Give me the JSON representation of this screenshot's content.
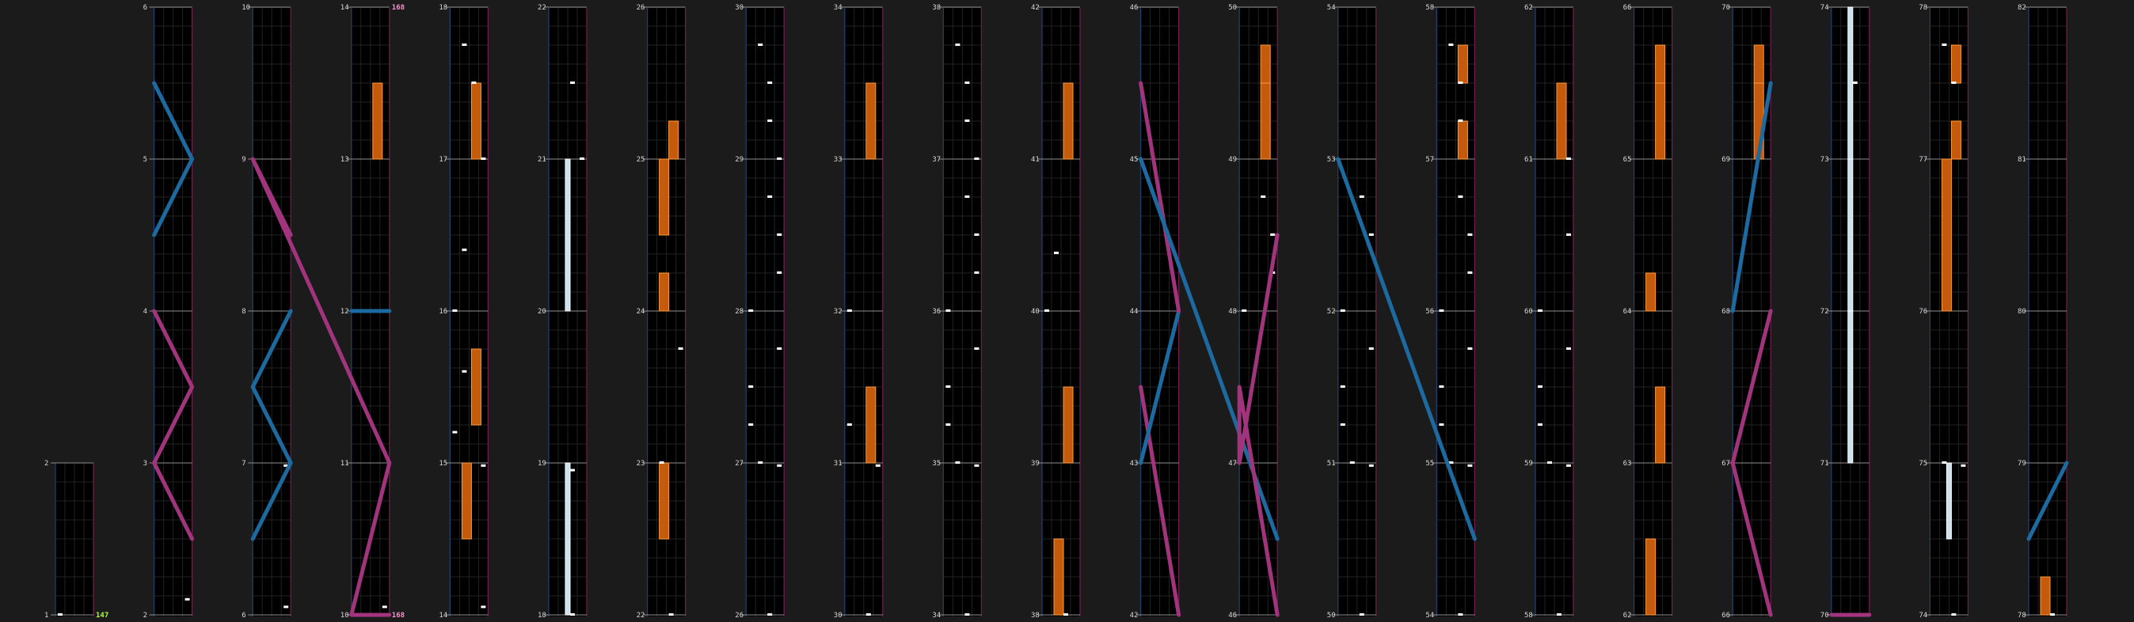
{
  "chart_data": {
    "type": "rhythm-game-chart",
    "measure_labels_shown": true,
    "combo_markers": [
      {
        "measure": 1,
        "value": "147",
        "color": "#b5ff3a"
      },
      {
        "measure": 10,
        "value": "168",
        "color": "#ff8fd2"
      },
      {
        "measure": 10,
        "value": "168",
        "color": "#ff8fd2",
        "at_top": true
      }
    ],
    "columns": [
      {
        "start": 1,
        "measures": 2
      },
      {
        "start": 2,
        "measures": 5
      },
      {
        "start": 6,
        "measures": 5
      },
      {
        "start": 10,
        "measures": 5
      },
      {
        "start": 14,
        "measures": 5
      },
      {
        "start": 18,
        "measures": 5
      },
      {
        "start": 22,
        "measures": 5
      },
      {
        "start": 26,
        "measures": 5
      },
      {
        "start": 30,
        "measures": 5
      },
      {
        "start": 34,
        "measures": 5
      },
      {
        "start": 38,
        "measures": 5
      },
      {
        "start": 42,
        "measures": 5
      },
      {
        "start": 46,
        "measures": 5
      },
      {
        "start": 50,
        "measures": 5
      },
      {
        "start": 54,
        "measures": 5
      },
      {
        "start": 58,
        "measures": 5
      },
      {
        "start": 62,
        "measures": 5
      },
      {
        "start": 66,
        "measures": 5
      },
      {
        "start": 70,
        "measures": 5
      },
      {
        "start": 74,
        "measures": 5
      },
      {
        "start": 78,
        "measures": 5
      }
    ],
    "notes": {
      "taps": [
        [
          1,
          0.1
        ],
        [
          2,
          0.1
        ],
        [
          6,
          0.05
        ],
        [
          6,
          0.98
        ],
        [
          10,
          0.05
        ],
        [
          14,
          0.05
        ],
        [
          14,
          0.98
        ],
        [
          18,
          0.0
        ],
        [
          15,
          0.2
        ],
        [
          15,
          0.6
        ],
        [
          16,
          0.0
        ],
        [
          16,
          0.4
        ],
        [
          17,
          0.0
        ],
        [
          17,
          0.5
        ],
        [
          17,
          0.75
        ],
        [
          18,
          0.95
        ],
        [
          21,
          0.0
        ],
        [
          21,
          0.5
        ],
        [
          22,
          0.0
        ],
        [
          23,
          0.0
        ],
        [
          23,
          0.75
        ],
        [
          26,
          0.0
        ],
        [
          26,
          0.98
        ],
        [
          27,
          0.0
        ],
        [
          27,
          0.25
        ],
        [
          27,
          0.5
        ],
        [
          27,
          0.75
        ],
        [
          28,
          0.0
        ],
        [
          28,
          0.25
        ],
        [
          28,
          0.5
        ],
        [
          28,
          0.75
        ],
        [
          29,
          0.0
        ],
        [
          29,
          0.25
        ],
        [
          29,
          0.5
        ],
        [
          29,
          0.75
        ],
        [
          30,
          0.0
        ],
        [
          30,
          0.98
        ],
        [
          31,
          0.25
        ],
        [
          32,
          0.0
        ],
        [
          35,
          0.0
        ],
        [
          35,
          0.25
        ],
        [
          35,
          0.5
        ],
        [
          35,
          0.75
        ],
        [
          36,
          0.0
        ],
        [
          36,
          0.25
        ],
        [
          36,
          0.5
        ],
        [
          36,
          0.75
        ],
        [
          37,
          0.0
        ],
        [
          37,
          0.25
        ],
        [
          37,
          0.5
        ],
        [
          37,
          0.75
        ],
        [
          34,
          0.0
        ],
        [
          34,
          0.98
        ],
        [
          38,
          0.0
        ],
        [
          40,
          0.0
        ],
        [
          40,
          0.38
        ],
        [
          48,
          0.0
        ],
        [
          48,
          0.25
        ],
        [
          48,
          0.5
        ],
        [
          48,
          0.75
        ],
        [
          50,
          0.0
        ],
        [
          50,
          0.98
        ],
        [
          51,
          0.0
        ],
        [
          51,
          0.25
        ],
        [
          51,
          0.5
        ],
        [
          51,
          0.75
        ],
        [
          52,
          0.0
        ],
        [
          52,
          0.5
        ],
        [
          52,
          0.75
        ],
        [
          54,
          0.0
        ],
        [
          54,
          0.98
        ],
        [
          55,
          0.0
        ],
        [
          55,
          0.25
        ],
        [
          55,
          0.5
        ],
        [
          55,
          0.75
        ],
        [
          56,
          0.0
        ],
        [
          56,
          0.25
        ],
        [
          56,
          0.5
        ],
        [
          56,
          0.75
        ],
        [
          57,
          0.25
        ],
        [
          57,
          0.5
        ],
        [
          57,
          0.75
        ],
        [
          58,
          0.0
        ],
        [
          58,
          0.98
        ],
        [
          59,
          0.0
        ],
        [
          59,
          0.25
        ],
        [
          59,
          0.5
        ],
        [
          59,
          0.75
        ],
        [
          60,
          0.0
        ],
        [
          60,
          0.5
        ],
        [
          61,
          0.0
        ],
        [
          74,
          0.0
        ],
        [
          74,
          0.98
        ],
        [
          75,
          0.0
        ],
        [
          73,
          0.5
        ],
        [
          77,
          0.5
        ],
        [
          77,
          0.75
        ],
        [
          78,
          0.0
        ]
      ],
      "holds": [
        [
          13,
          0.0,
          0.5
        ],
        [
          14,
          0.5,
          1.0
        ],
        [
          17,
          0.0,
          0.5
        ],
        [
          15,
          0.25,
          0.75
        ],
        [
          22,
          0.5,
          1.0
        ],
        [
          24,
          0.5,
          1.0
        ],
        [
          24,
          0.0,
          0.25
        ],
        [
          25,
          0.0,
          0.25
        ],
        [
          31,
          0.0,
          0.5
        ],
        [
          33,
          0.0,
          0.5
        ],
        [
          38,
          0.0,
          0.5
        ],
        [
          39,
          0.0,
          0.5
        ],
        [
          41,
          0.0,
          0.5
        ],
        [
          49,
          0.0,
          0.5
        ],
        [
          49,
          0.5,
          0.75
        ],
        [
          57,
          0.0,
          0.25
        ],
        [
          57,
          0.5,
          0.75
        ],
        [
          61,
          0.0,
          0.5
        ],
        [
          62,
          0.0,
          0.5
        ],
        [
          63,
          0.0,
          0.5
        ],
        [
          64,
          0.0,
          0.25
        ],
        [
          65,
          0.0,
          0.5
        ],
        [
          65,
          0.5,
          0.75
        ],
        [
          69,
          0.0,
          0.5
        ],
        [
          69,
          0.5,
          0.75
        ],
        [
          76,
          0.0,
          1.0
        ],
        [
          77,
          0.0,
          0.25
        ],
        [
          77,
          0.5,
          0.75
        ],
        [
          78,
          0.0,
          0.25
        ]
      ],
      "ex_holds": [
        [
          18,
          0.0,
          1.0
        ],
        [
          20,
          0.0,
          1.0
        ],
        [
          71,
          0.0,
          1.0
        ],
        [
          72,
          0.0,
          1.0
        ],
        [
          73,
          0.0,
          1.0
        ],
        [
          74,
          0.5,
          1.0
        ]
      ],
      "arcs": [
        {
          "color": "blue",
          "pts": [
            [
              5,
              0.5,
              0.0
            ],
            [
              5,
              0.0,
              1.0
            ],
            [
              4,
              0.5,
              0.0
            ]
          ]
        },
        {
          "color": "pink",
          "pts": [
            [
              4,
              0.0,
              0.0
            ],
            [
              3,
              0.5,
              1.0
            ],
            [
              3,
              0.0,
              0.0
            ],
            [
              2,
              0.5,
              1.0
            ]
          ]
        },
        {
          "color": "pink",
          "pts": [
            [
              10,
              0.0,
              0.0
            ],
            [
              10,
              1.0,
              1.0
            ],
            [
              9,
              0.0,
              0.0
            ],
            [
              8,
              0.5,
              1.0
            ]
          ]
        },
        {
          "color": "blue",
          "pts": [
            [
              8,
              0.0,
              1.0
            ],
            [
              7,
              0.5,
              0.0
            ],
            [
              7,
              0.0,
              1.0
            ],
            [
              6,
              0.5,
              0.0
            ]
          ]
        },
        {
          "color": "blue",
          "pts": [
            [
              12,
              0.0,
              0.0
            ],
            [
              12,
              0.0,
              1.0
            ]
          ]
        },
        {
          "color": "pink",
          "pts": [
            [
              10,
              0.0,
              1.0
            ],
            [
              10,
              0.0,
              0.0
            ]
          ]
        },
        {
          "color": "pink",
          "pts": [
            [
              42,
              0.0,
              1.0
            ],
            [
              43,
              0.5,
              0.0
            ]
          ]
        },
        {
          "color": "blue",
          "pts": [
            [
              43,
              0.0,
              0.0
            ],
            [
              44,
              0.0,
              1.0
            ]
          ]
        },
        {
          "color": "pink",
          "pts": [
            [
              44,
              0.0,
              1.0
            ],
            [
              45,
              0.5,
              0.0
            ]
          ]
        },
        {
          "color": "blue",
          "pts": [
            [
              45,
              0.0,
              0.0
            ],
            [
              46,
              0.5,
              1.0
            ]
          ]
        },
        {
          "color": "pink",
          "pts": [
            [
              46,
              0.0,
              1.0
            ],
            [
              47,
              0.5,
              0.0
            ],
            [
              47,
              0.0,
              0.0
            ],
            [
              48,
              0.5,
              1.0
            ]
          ]
        },
        {
          "color": "blue",
          "pts": [
            [
              53,
              0.0,
              0.0
            ],
            [
              54,
              0.5,
              1.0
            ]
          ]
        },
        {
          "color": "pink",
          "pts": [
            [
              66,
              0.0,
              1.0
            ],
            [
              67,
              0.0,
              0.0
            ],
            [
              68,
              0.0,
              1.0
            ]
          ]
        },
        {
          "color": "blue",
          "pts": [
            [
              68,
              0.0,
              0.0
            ],
            [
              69,
              0.5,
              1.0
            ]
          ]
        },
        {
          "color": "pink",
          "pts": [
            [
              70,
              0.0,
              0.0
            ],
            [
              70,
              0.0,
              1.0
            ]
          ]
        },
        {
          "color": "blue",
          "pts": [
            [
              78,
              0.5,
              0.0
            ],
            [
              79,
              0.0,
              1.0
            ]
          ]
        }
      ]
    }
  }
}
